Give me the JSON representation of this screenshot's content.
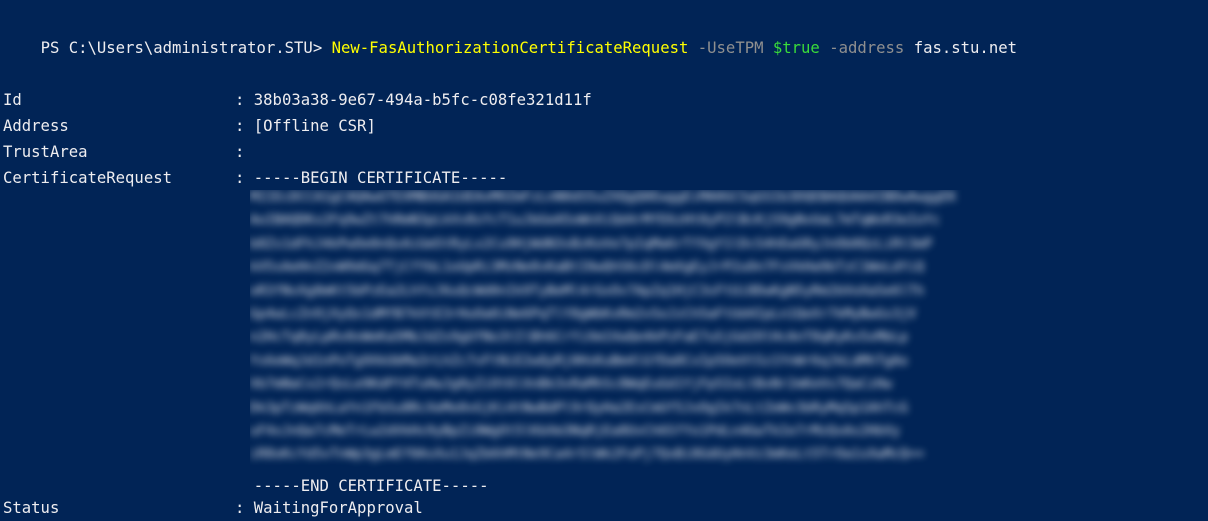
{
  "prompt": {
    "text": "PS C:\\Users\\administrator.STU> ",
    "cmdlet": "New-FasAuthorizationCertificateRequest",
    "param1": " -UseTPM ",
    "param1_value": "$true",
    "param2": " -address ",
    "param2_value": "fas.stu.net"
  },
  "output": {
    "properties": [
      {
        "name": "Id",
        "sep": ": ",
        "value": "38b03a38-9e67-494a-b5fc-c08fe321d11f"
      },
      {
        "name": "Address",
        "sep": ": ",
        "value": "[Offline CSR]"
      },
      {
        "name": "TrustArea",
        "sep": ":",
        "value": ""
      },
      {
        "name": "CertificateRequest",
        "sep": ": ",
        "value": "-----BEGIN CERTIFICATE-----"
      }
    ],
    "cert_end": "-----END CERTIFICATE-----",
    "status": {
      "name": "Status",
      "sep": ": ",
      "value": "WaitingForApproval"
    }
  },
  "colors": {
    "background": "#012456",
    "text": "#eeedf0",
    "cmdlet": "#ffff00",
    "parameter": "#8f8f8f",
    "variable": "#3adb3a"
  }
}
